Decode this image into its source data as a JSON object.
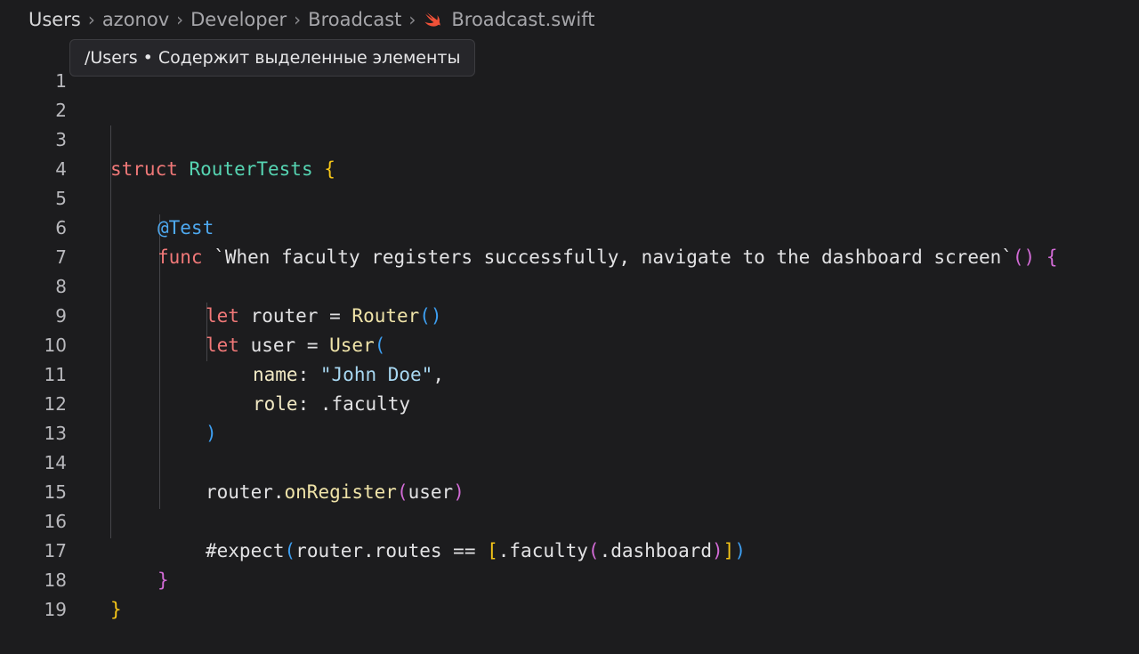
{
  "breadcrumb": {
    "items": [
      "Users",
      "azonov",
      "Developer",
      "Broadcast"
    ],
    "file": "Broadcast.swift",
    "file_icon": "swift-icon",
    "accent": "#f05138"
  },
  "tooltip": {
    "text": "/Users • Содержит выделенные элементы"
  },
  "lines": {
    "n1": "1",
    "n2": "2",
    "n3": "3",
    "n4": "4",
    "n5": "5",
    "n6": "6",
    "n7": "7",
    "n8": "8",
    "n9": "9",
    "n10": "10",
    "n11": "11",
    "n12": "12",
    "n13": "13",
    "n14": "14",
    "n15": "15",
    "n16": "16",
    "n17": "17",
    "n18": "18",
    "n19": "19"
  },
  "code": {
    "l3": {
      "kw": "struct",
      "name": "RouterTests",
      "brace": "{"
    },
    "l5": {
      "attr": "@Test"
    },
    "l6": {
      "kw": "func",
      "name": "`When faculty registers successfully, navigate to the dashboard screen`",
      "parens": "()",
      "brace": "{"
    },
    "l8": {
      "kw": "let",
      "var": "router",
      "eq": "=",
      "type": "Router",
      "parens": "()"
    },
    "l9": {
      "kw": "let",
      "var": "user",
      "eq": "=",
      "type": "User",
      "open": "("
    },
    "l10": {
      "label": "name",
      "colon": ":",
      "str": "\"John Doe\"",
      "comma": ","
    },
    "l11": {
      "label": "role",
      "colon": ":",
      "value": ".faculty"
    },
    "l12": {
      "close": ")"
    },
    "l14": {
      "obj": "router",
      "dot": ".",
      "method": "onRegister",
      "open": "(",
      "arg": "user",
      "close": ")"
    },
    "l16": {
      "macro": "#expect",
      "open": "(",
      "expr": "router.routes == ",
      "bopen": "[",
      "case": ".faculty",
      "iopen": "(",
      "inner": ".dashboard",
      "iclose": ")",
      "bclose": "]",
      "close": ")"
    },
    "l17": {
      "brace": "}"
    },
    "l18": {
      "brace": "}"
    }
  }
}
